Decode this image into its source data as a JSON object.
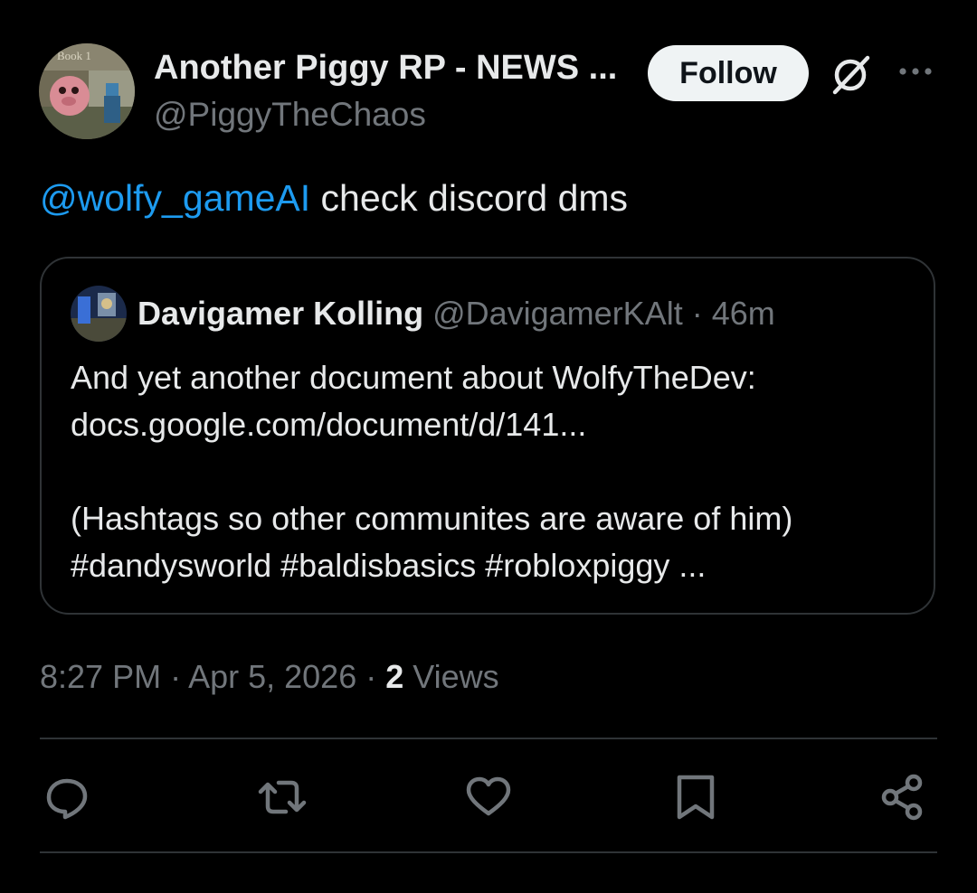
{
  "author": {
    "display_name": "Another Piggy RP - NEWS ...",
    "handle": "@PiggyTheChaos",
    "avatar_text": "Book 1"
  },
  "header": {
    "follow_label": "Follow",
    "grok_icon": "grok-icon",
    "more_icon": "more-icon"
  },
  "tweet": {
    "mention": "@wolfy_gameAI",
    "text": " check discord dms"
  },
  "quoted": {
    "name": "Davigamer Kolling",
    "handle_time": " @DavigamerKAlt · 46m",
    "lines": [
      "And yet another document about WolfyTheDev:",
      "docs.google.com/document/d/141...",
      "",
      "(Hashtags so other communites are aware of him)",
      "#dandysworld #baldisbasics #robloxpiggy ..."
    ]
  },
  "meta": {
    "timestamp": "8:27 PM · Apr 5, 2026 · ",
    "views_count": "2",
    "views_label": " Views"
  },
  "actions": {
    "icons": [
      "reply-icon",
      "retweet-icon",
      "like-icon",
      "bookmark-icon",
      "share-icon"
    ]
  },
  "colors": {
    "background": "#000000",
    "text_primary": "#e7e9ea",
    "text_secondary": "#71767b",
    "link": "#1d9bf0",
    "border": "#2f3336",
    "follow_bg": "#eff3f4"
  }
}
